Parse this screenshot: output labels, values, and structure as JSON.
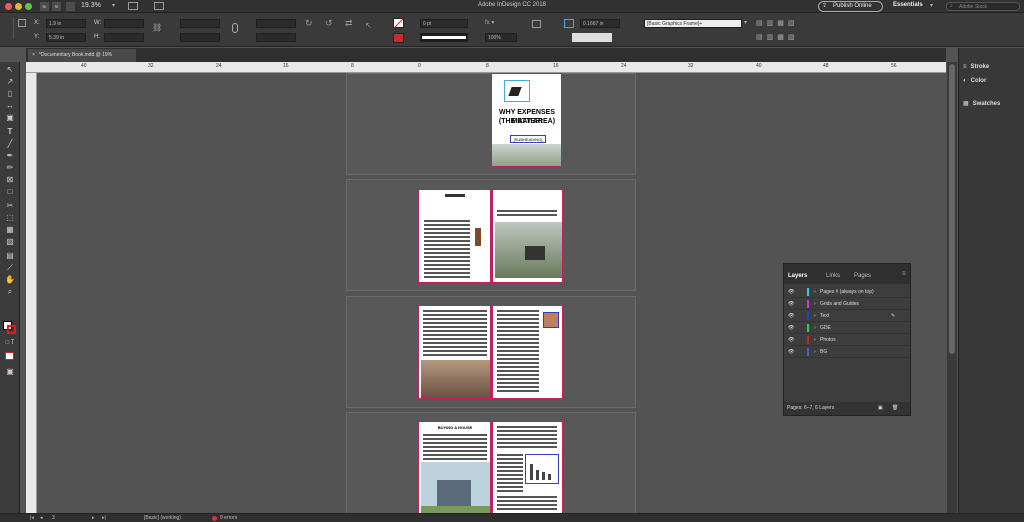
{
  "app": {
    "title": "Adobe InDesign CC 2018",
    "zoom": "19.3%",
    "publish_label": "Publish Online",
    "workspace": "Essentials",
    "search_placeholder": "Adobe Stock"
  },
  "control": {
    "x_label": "X:",
    "x_value": "1.9 in",
    "y_label": "Y:",
    "y_value": "5.39 in",
    "w_label": "W:",
    "h_label": "H:",
    "stroke_weight": "0 pt",
    "opacity": "100%",
    "offset": "0.1667 in",
    "style": "[Basic Graphics Frame]+"
  },
  "document": {
    "tab_label": "*Documentary Book.indd @ 19%"
  },
  "ruler": {
    "ticks": [
      "40",
      "32",
      "24",
      "16",
      "8",
      "0",
      "8",
      "16",
      "24",
      "32",
      "40",
      "48",
      "56"
    ]
  },
  "cover": {
    "title_line1": "WHY EXPENSES MATTER:",
    "title_line2": "(THE BAY AREA)",
    "subtitle": "[SUBHEADING]"
  },
  "page2_heading": "BUYING A HOUSE",
  "right_panels": {
    "stroke": "Stroke",
    "color": "Color",
    "swatches": "Swatches"
  },
  "layers_panel": {
    "tabs": [
      "Layers",
      "Links",
      "Pages"
    ],
    "rows": [
      {
        "name": "Pages # (always on top)",
        "color": "#2fd0e0"
      },
      {
        "name": "Grids and Guides",
        "color": "#c040d0"
      },
      {
        "name": "Text",
        "color": "#2040d0"
      },
      {
        "name": "GDE",
        "color": "#30d050"
      },
      {
        "name": "Photos",
        "color": "#d02020"
      },
      {
        "name": "BG",
        "color": "#4060e0"
      }
    ],
    "footer": "Pages: 6–7, 6 Layers"
  },
  "status": {
    "page": "3",
    "style": "[Basic] (working)",
    "errors": "9 errors"
  }
}
